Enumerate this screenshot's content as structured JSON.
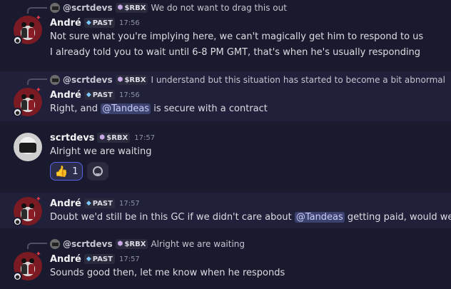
{
  "messages": [
    {
      "reply": {
        "user": "@scrtdevs",
        "tag": "$RBX",
        "text": "We do not want to drag this out"
      },
      "user": "André",
      "tag": "PAST",
      "time": "17:56",
      "lines": [
        "Not sure what you're implying here, we can't magically get him to respond to us",
        "I already told you to wait until 6-8 PM GMT, that's when he's usually responding"
      ]
    },
    {
      "reply": {
        "user": "@scrtdevs",
        "tag": "$RBX",
        "text": "I understand but this situation has started to become a bit abnormal"
      },
      "user": "André",
      "tag": "PAST",
      "time": "17:56",
      "line_pre": "Right, and ",
      "mention": "@Tandeas",
      "line_post": " is secure with a contract"
    },
    {
      "user": "scrtdevs",
      "tag": "$RBX",
      "time": "17:57",
      "lines": [
        "Alright we are waiting"
      ],
      "reaction": {
        "emoji": "thumbs-up-emoji",
        "count": "1"
      }
    },
    {
      "user": "André",
      "tag": "PAST",
      "time": "17:57",
      "line_pre": "Doubt we'd still be in this GC if we didn't care about ",
      "mention": "@Tandeas",
      "line_post": " getting paid, would we?"
    },
    {
      "reply": {
        "user": "@scrtdevs",
        "tag": "$RBX",
        "text": "Alright we are waiting"
      },
      "user": "André",
      "tag": "PAST",
      "time": "17:57",
      "lines": [
        "Sounds good then, let me know when he responds"
      ]
    }
  ],
  "colors": {
    "background": "#1a1a2e",
    "highlight": "#20203a",
    "mention_bg": "#3c4270",
    "reaction_border": "#5865f2"
  }
}
